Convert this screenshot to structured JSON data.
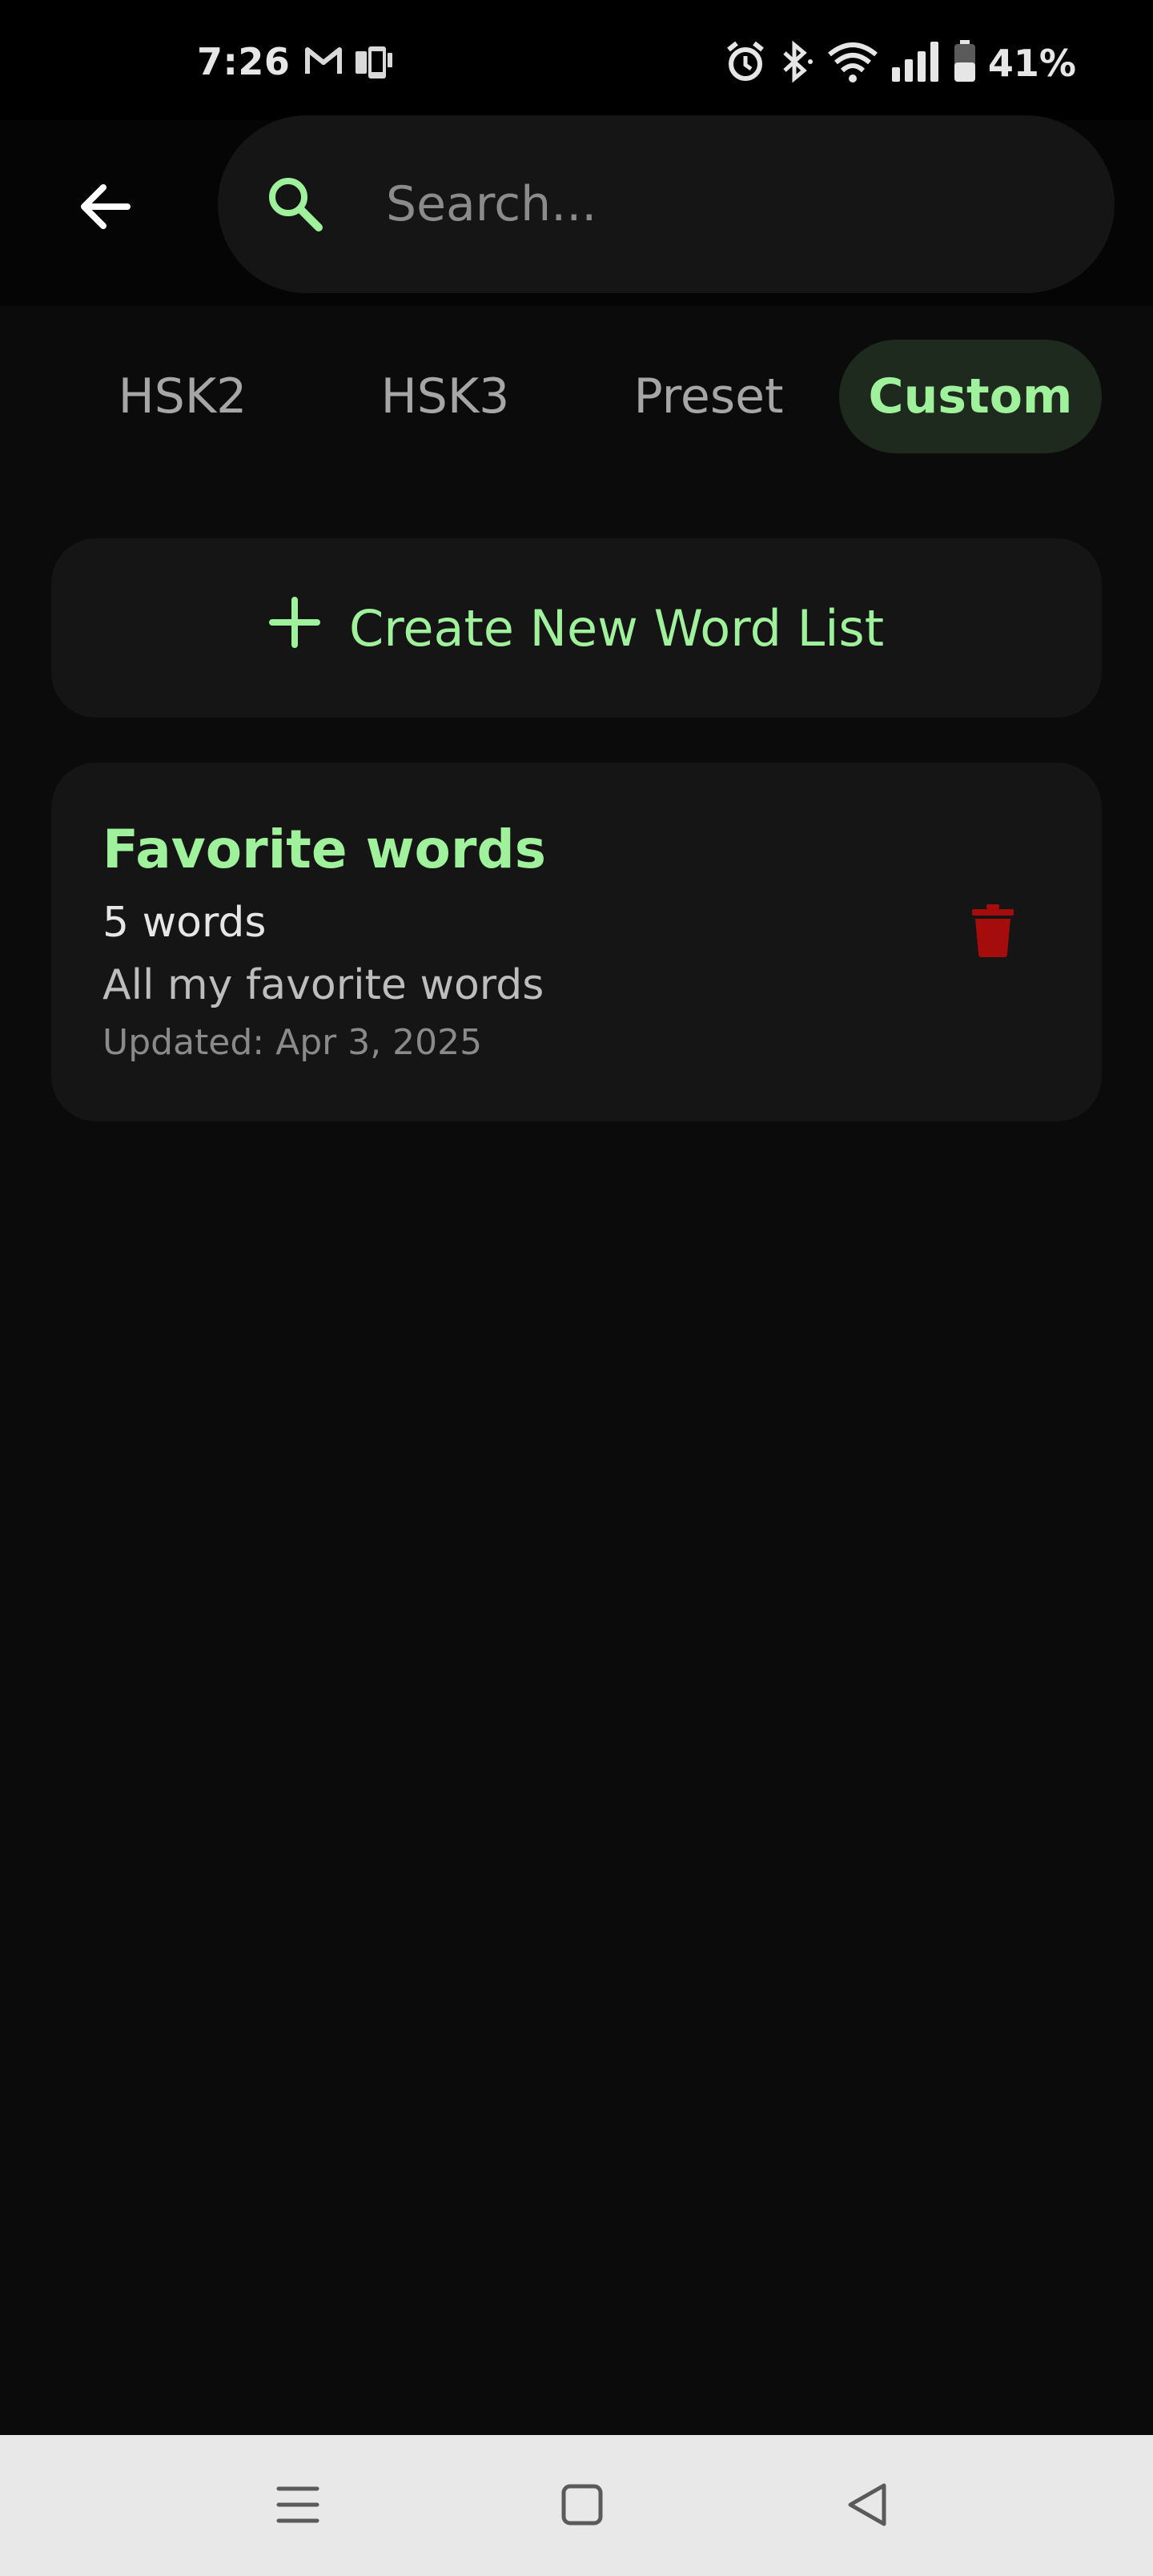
{
  "status": {
    "time": "7:26",
    "battery": "41%",
    "icons": [
      "gmail-icon",
      "device-icon",
      "alarm-icon",
      "bluetooth-icon",
      "wifi-icon",
      "signal-icon",
      "battery-icon"
    ]
  },
  "search": {
    "placeholder": "Search...",
    "value": ""
  },
  "tabs": [
    {
      "label": "HSK2",
      "active": false
    },
    {
      "label": "HSK3",
      "active": false
    },
    {
      "label": "Preset",
      "active": false
    },
    {
      "label": "Custom",
      "active": true
    }
  ],
  "create": {
    "label": "Create New Word List"
  },
  "word_lists": [
    {
      "title": "Favorite words",
      "count": "5 words",
      "description": "All my favorite words",
      "updated": "Updated: Apr 3, 2025"
    }
  ],
  "colors": {
    "accent": "#9ff29b",
    "delete": "#a50d0d",
    "background": "#0b0b0b",
    "card": "#151515"
  }
}
